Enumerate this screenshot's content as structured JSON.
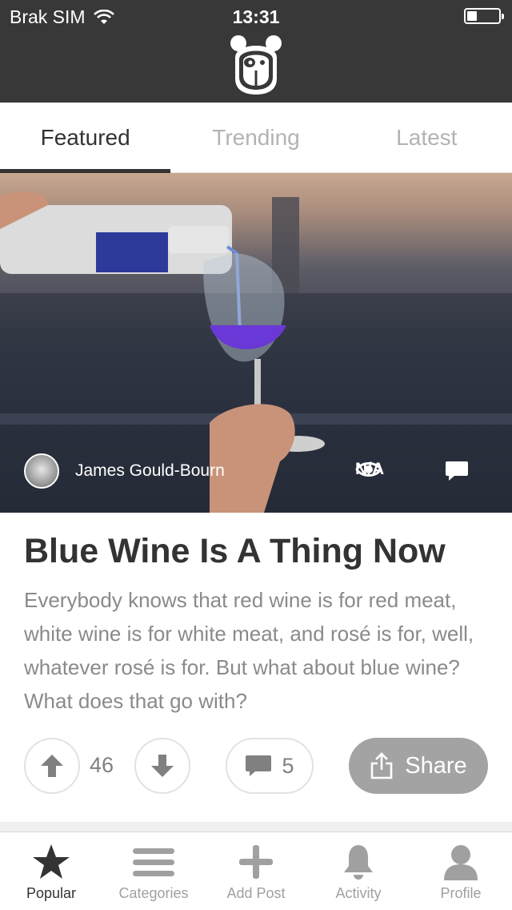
{
  "status_bar": {
    "carrier": "Brak SIM",
    "time": "13:31"
  },
  "header": {
    "logo_icon": "panda-logo-icon"
  },
  "tabs": [
    {
      "label": "Featured",
      "active": true
    },
    {
      "label": "Trending",
      "active": false
    },
    {
      "label": "Latest",
      "active": false
    }
  ],
  "post": {
    "author": "James Gould-Bourn",
    "views": "N/A",
    "comments": "5",
    "title": "Blue Wine Is A Thing Now",
    "excerpt": "Everybody knows that red wine is for red meat, white wine is for white meat, and rosé is for, well, whatever rosé is for. But what about blue wine? What does that go with?",
    "votes": "46",
    "comment_count": "5",
    "share_label": "Share"
  },
  "tabbar": [
    {
      "label": "Popular",
      "icon": "star-icon",
      "active": true
    },
    {
      "label": "Categories",
      "icon": "menu-icon",
      "active": false
    },
    {
      "label": "Add Post",
      "icon": "plus-icon",
      "active": false
    },
    {
      "label": "Activity",
      "icon": "bell-icon",
      "active": false
    },
    {
      "label": "Profile",
      "icon": "user-icon",
      "active": false
    }
  ],
  "colors": {
    "header_bg": "#383838",
    "accent": "#333333",
    "muted": "#a0a0a0",
    "share_bg": "#a3a3a3"
  }
}
